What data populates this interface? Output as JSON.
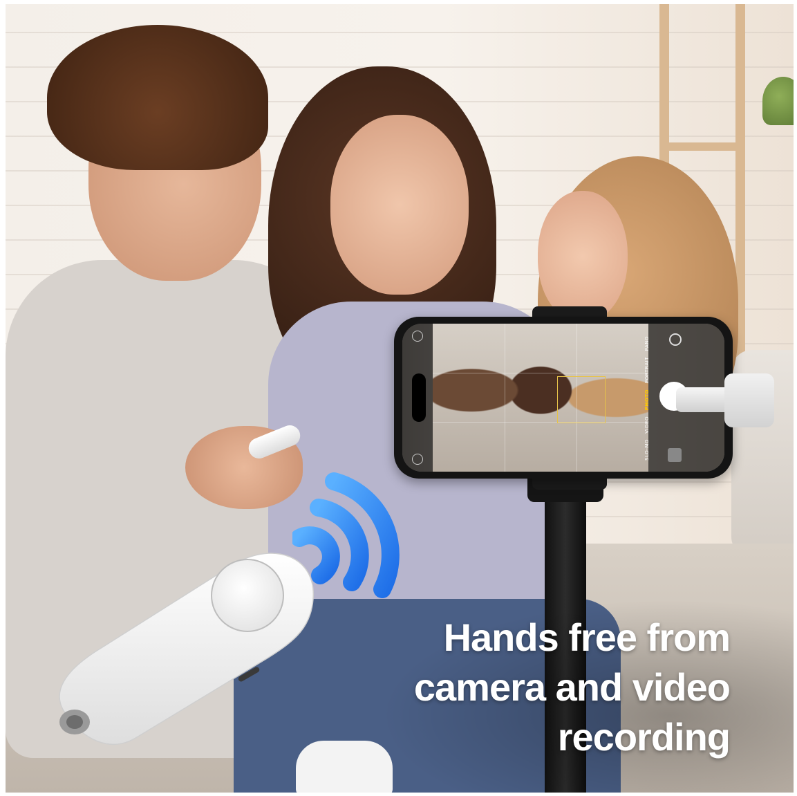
{
  "headline": {
    "line1": "Hands free from",
    "line2": "camera and video",
    "line3": "recording"
  },
  "camera_modes": [
    "SLO-MO",
    "VIDEO",
    "PHOTO",
    "PORTRAIT",
    "PANO"
  ],
  "active_mode": "PHOTO",
  "colors": {
    "wave_blue": "#2f8cff",
    "headline_text": "#ffffff",
    "focus_box": "#e6c34a",
    "active_mode": "#ffcc00"
  },
  "icons": [
    "wireless-waves-icon",
    "flash-icon",
    "live-photo-icon",
    "camera-flip-icon",
    "shutter-button-icon"
  ]
}
